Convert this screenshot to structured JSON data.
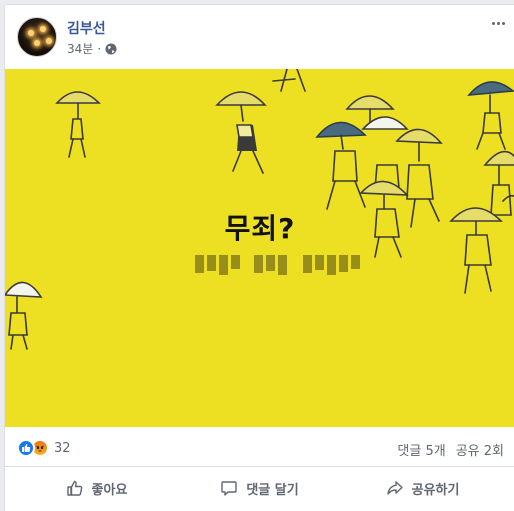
{
  "post": {
    "author": "김부선",
    "time": "34분",
    "privacy_icon": "globe-icon",
    "more_icon": "more-dots-icon"
  },
  "image": {
    "headline": "무죄?",
    "blurred_text": "",
    "background_color": "#eddf22",
    "umbrella_color_dark": "#4a6a80"
  },
  "stats": {
    "reaction_icons": [
      "like-reaction-icon",
      "angry-reaction-icon"
    ],
    "reaction_count": "32",
    "comments": "댓글 5개",
    "shares": "공유 2회"
  },
  "actions": {
    "like": "좋아요",
    "comment": "댓글 달기",
    "share": "공유하기"
  },
  "colors": {
    "link_blue": "#385898",
    "like_blue": "#1877f2",
    "meta_gray": "#606770"
  }
}
